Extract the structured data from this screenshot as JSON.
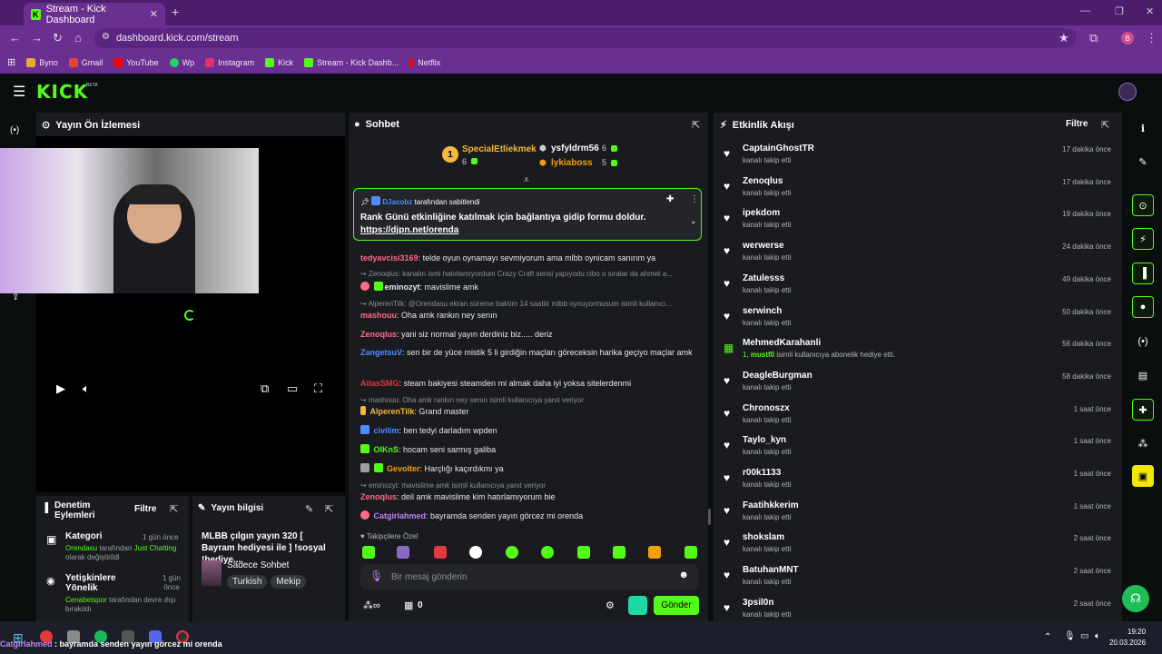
{
  "browser": {
    "tab_title": "Stream - Kick Dashboard",
    "url": "dashboard.kick.com/stream",
    "profile_initial": "B",
    "bookmarks": [
      {
        "label": "Byno",
        "color": "#e9a93a"
      },
      {
        "label": "Gmail",
        "color": "#ea4335"
      },
      {
        "label": "YouTube",
        "color": "#ff0000"
      },
      {
        "label": "Wp",
        "color": "#25d366"
      },
      {
        "label": "Instagram",
        "color": "#e1306c"
      },
      {
        "label": "Kick",
        "color": "#53fc18"
      },
      {
        "label": "Stream - Kick Dashb...",
        "color": "#53fc18"
      },
      {
        "label": "Netflix",
        "color": "#e50914"
      }
    ]
  },
  "brand": {
    "logo": "KICK",
    "beta": "BETA",
    "accent": "#53fc18"
  },
  "preview": {
    "title": "Yayın Ön İzlemesi"
  },
  "moderation": {
    "title": "Denetim Eylemleri",
    "filter": "Filtre",
    "items": [
      {
        "title": "Kategori",
        "time": "1 gün önce",
        "actor": "Orendasu",
        "text1": " tarafından ",
        "highlight": "Just Chatting",
        "text2": " olarak değiştirildi"
      },
      {
        "title": "Yetişkinlere Yönelik",
        "time": "1 gün önce",
        "actor": "Cenabetspor",
        "text1": " tarafından devre dışı bırakıldı"
      }
    ]
  },
  "stream_info": {
    "title": "Yayın bilgisi",
    "stream_title": "MLBB çılgın yayın 320 [ Bayram hediyesi ile ] !sosyal !hediye...",
    "category": "Sadece Sohbet",
    "tags": [
      "Turkish",
      "Mekip"
    ]
  },
  "chat": {
    "title": "Sohbet",
    "leaders": [
      {
        "name": "SpecialEtliekmek",
        "count": "6",
        "rank": "1"
      },
      {
        "name": "ysfyldrm56",
        "count": "6"
      },
      {
        "name": "lykiaboss",
        "count": "5"
      }
    ],
    "pinned": {
      "by": "DJacobz",
      "by_suffix": " tarafından sabitlendi",
      "text": "Rank Günü etkinliğine katılmak için bağlantıya gidip formu doldur.",
      "link": "https://djpn.net/orenda"
    },
    "messages": [
      {
        "user": "tedyavcisi3169",
        "color": "#ff6b8a",
        "text": ": telde oyun oynamayı sevmiyorum ama mlbb oynicam sanırım ya"
      },
      {
        "reply": "Zenoqlus: kanalın ismi hatırlamıyordum Crazy Craft serisi yapıyodu cibo o sıralar da ahmet a..."
      },
      {
        "user": "eminozyt",
        "color": "#e8e8e8",
        "text": ": mavislime amk"
      },
      {
        "reply": "AlperenTilk: @Orendasu ekran süreme baktım 14 saattir mlbb oynuyormusum isimli kullanıcı..."
      },
      {
        "user": "mashouu",
        "color": "#ff6b8a",
        "text": ": Oha amk rankın ney senın"
      },
      {
        "user": "Zenoqlus",
        "color": "#ff6b8a",
        "text": ": yani siz normal yayın derdiniz biz..... deriz"
      },
      {
        "user": "ZangetsuV",
        "color": "#4f8cff",
        "text": ": sen bir de yüce mistik 5 li girdiğin maçları göreceksin harika geçiyo maçlar amk"
      },
      {
        "user": "AtlasSMG",
        "color": "#e0393e",
        "text": ": steam bakiyesi steamden mi almak daha iyi yoksa sitelerdenmi"
      },
      {
        "reply": "mashouu: Oha amk rankın ney senın isimli kullanıcıya yanıt veriyor"
      },
      {
        "user": "AlperenTilk",
        "color": "#f5b83d",
        "text": ": Grand master"
      },
      {
        "user": "civilim",
        "color": "#4f8cff",
        "text": ": ben tedyi darladım wpden"
      },
      {
        "user": "OlKnS",
        "color": "#53fc18",
        "text": ": hocam seni sarmış galiba"
      },
      {
        "user": "Gevolter",
        "color": "#f59e0b",
        "text": ": Harçlığı kaçırdıkmı ya"
      },
      {
        "reply": "eminozyt: mavislime amk isimli kullanıcıya yanıt veriyor"
      },
      {
        "user": "Zenoqlus",
        "color": "#ff6b8a",
        "text": ": deil amk mavislime kim hatırlamıyorum bie"
      },
      {
        "user": "Catgirlahmed",
        "color": "#c084fc",
        "text": ": bayramda senden yayın görcez mi orenda"
      }
    ],
    "follower_label": "Takipçilere Özel",
    "placeholder": "Bir mesaj gönderin",
    "points": "0",
    "send": "Gönder"
  },
  "events": {
    "title": "Etkinlik Akışı",
    "filter": "Filtre",
    "items": [
      {
        "name": "CaptainGhostTR",
        "sub": "kanalı takip etti",
        "time": "17 dakika önce"
      },
      {
        "name": "Zenoqlus",
        "sub": "kanalı takip etti",
        "time": "17 dakika önce"
      },
      {
        "name": "ipekdom",
        "sub": "kanalı takip etti",
        "time": "19 dakika önce"
      },
      {
        "name": "werwerse",
        "sub": "kanalı takip etti",
        "time": "24 dakika önce"
      },
      {
        "name": "Zatulesss",
        "sub": "kanalı takip etti",
        "time": "49 dakika önce"
      },
      {
        "name": "serwinch",
        "sub": "kanalı takip etti",
        "time": "50 dakika önce"
      },
      {
        "name": "MehmedKarahanli",
        "sub_prefix": "1, ",
        "sub_highlight": "mustf0",
        "sub": " isimli kullanıcıya abonelik hediye etti.",
        "time": "56 dakika önce",
        "gift": true
      },
      {
        "name": "DeagleBurgman",
        "sub": "kanalı takip etti",
        "time": "58 dakika önce"
      },
      {
        "name": "Chronoszx",
        "sub": "kanalı takip etti",
        "time": "1 saat önce"
      },
      {
        "name": "Taylo_kyn",
        "sub": "kanalı takip etti",
        "time": "1 saat önce"
      },
      {
        "name": "r00k1133",
        "sub": "kanalı takip etti",
        "time": "1 saat önce"
      },
      {
        "name": "Faatihkkerim",
        "sub": "kanalı takip etti",
        "time": "1 saat önce"
      },
      {
        "name": "shokslam",
        "sub": "kanalı takip etti",
        "time": "2 saat önce"
      },
      {
        "name": "BatuhanMNT",
        "sub": "kanalı takip etti",
        "time": "2 saat önce"
      },
      {
        "name": "3psil0n",
        "sub": "kanalı takip etti",
        "time": "2 saat önce"
      }
    ]
  },
  "taskbar": {
    "toast_user": "Catgirlahmed",
    "toast_text": " : bayramda senden yayın görcez mi orenda",
    "time": "19:20",
    "date": "20.03.2026"
  }
}
